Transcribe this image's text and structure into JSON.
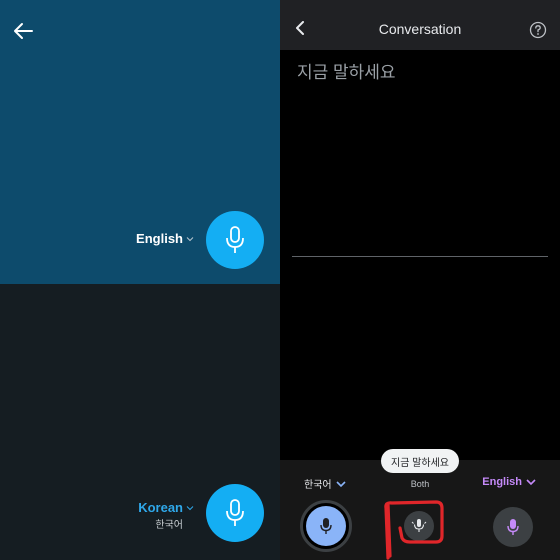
{
  "left_panel": {
    "top_language": "English",
    "bottom_language": "Korean",
    "bottom_language_native": "한국어",
    "colors": {
      "top_bg": "#0d4b6c",
      "bottom_bg": "#151d22",
      "mic": "#14aef3",
      "korean_label": "#2fa8ea"
    },
    "icons": [
      "back-arrow-icon",
      "chevron-down-icon",
      "microphone-icon"
    ]
  },
  "right_panel": {
    "header": {
      "title": "Conversation"
    },
    "prompt": "지금 말하세요",
    "tooltip": "지금 말하세요",
    "languages": {
      "left": "한국어",
      "middle": "Both",
      "right": "English"
    },
    "colors": {
      "header_bg": "#202124",
      "left_mic": "#8ab4f8",
      "right_lang": "#c58af9",
      "annotation": "#e0262a"
    },
    "icons": [
      "chevron-left-icon",
      "help-circle-icon",
      "chevron-down-icon",
      "microphone-icon",
      "dual-microphone-icon"
    ]
  }
}
